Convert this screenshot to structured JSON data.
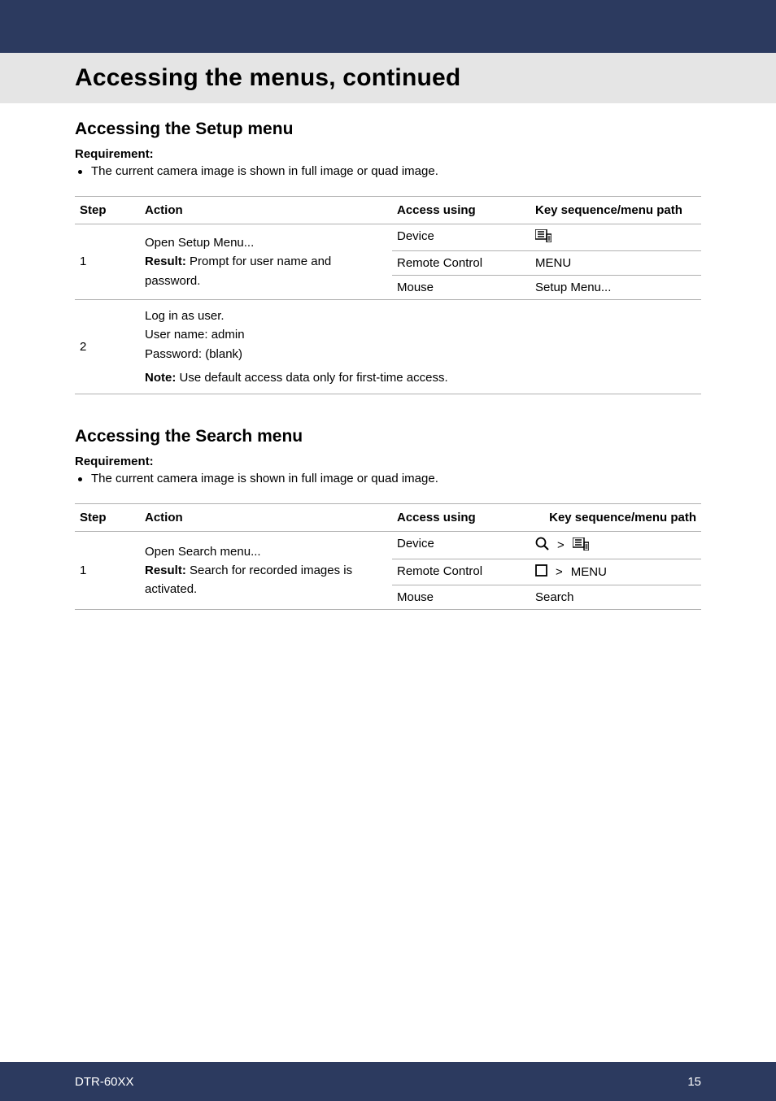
{
  "header": {
    "title": "Accessing the menus, continued"
  },
  "section1": {
    "heading": "Accessing the Setup menu",
    "req_label": "Requirement:",
    "req_item": "The current camera image is shown in full image or quad image.",
    "th_step": "Step",
    "th_action": "Action",
    "th_access": "Access using",
    "th_key": "Key sequence/menu path",
    "row1": {
      "step": "1",
      "action_line1": "Open Setup Menu...",
      "action_result_label": "Result:",
      "action_result_text": " Prompt for user name and password.",
      "access_device": "Device",
      "access_remote": "Remote Control",
      "access_mouse": "Mouse",
      "key_remote": "MENU",
      "key_mouse": "Setup Menu..."
    },
    "row2": {
      "step": "2",
      "line1": "Log in as user.",
      "line2": "User name: admin",
      "line3": "Password: (blank)",
      "note_label": "Note:",
      "note_text": " Use default access data only for first-time access."
    }
  },
  "section2": {
    "heading": "Accessing the Search menu",
    "req_label": "Requirement:",
    "req_item": "The current camera image is shown in full image or quad image.",
    "th_step": "Step",
    "th_action": "Action",
    "th_access": "Access using",
    "th_key": "Key sequence/menu path",
    "row1": {
      "step": "1",
      "action_line1": "Open Search menu...",
      "action_result_label": "Result:",
      "action_result_text": " Search for recorded images is activated.",
      "access_device": "Device",
      "access_remote": "Remote Control",
      "access_mouse": "Mouse",
      "key_remote": "MENU",
      "key_mouse": "Search"
    }
  },
  "footer": {
    "left": "DTR-60XX",
    "right": "15"
  }
}
